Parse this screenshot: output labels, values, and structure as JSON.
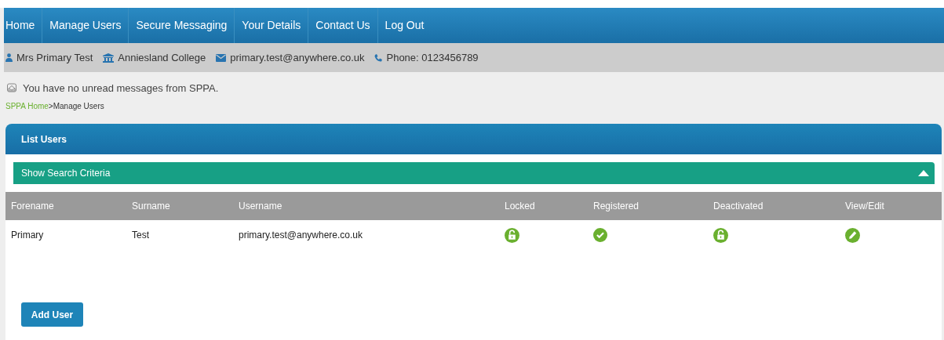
{
  "nav": [
    {
      "label": "Home"
    },
    {
      "label": "Manage Users"
    },
    {
      "label": "Secure Messaging"
    },
    {
      "label": "Your Details"
    },
    {
      "label": "Contact Us"
    },
    {
      "label": "Log Out"
    }
  ],
  "user_bar": {
    "name": "Mrs Primary Test",
    "organisation": "Anniesland College",
    "email": "primary.test@anywhere.co.uk",
    "phone": "Phone: 0123456789"
  },
  "message": "You have no unread messages from SPPA.",
  "breadcrumb": {
    "link": "SPPA Home",
    "separator": ">",
    "current": "Manage Users"
  },
  "panel": {
    "title": "List Users",
    "search": {
      "label": "Show Search Criteria",
      "expanded": true
    },
    "table": {
      "columns": [
        "Forename",
        "Surname",
        "Username",
        "Locked",
        "Registered",
        "Deactivated",
        "View/Edit"
      ],
      "rows": [
        {
          "forename": "Primary",
          "surname": "Test",
          "username": "primary.test@anywhere.co.uk",
          "locked": false,
          "registered": true,
          "deactivated": false
        }
      ]
    },
    "add_button": "Add User"
  }
}
